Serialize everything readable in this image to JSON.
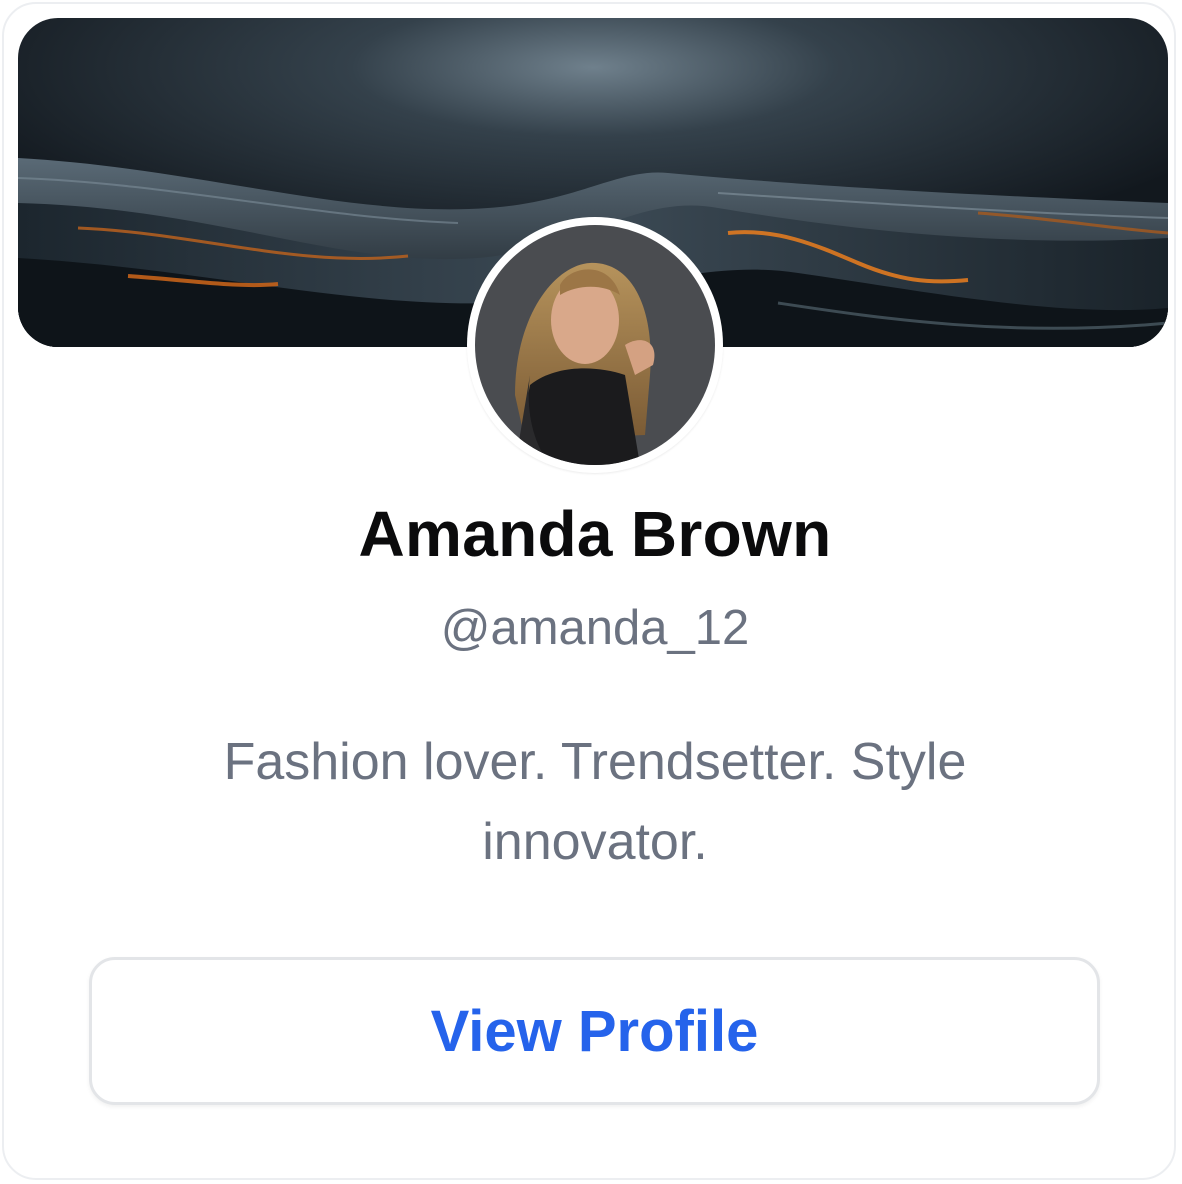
{
  "profile": {
    "name": "Amanda Brown",
    "handle": "@amanda_12",
    "bio": "Fashion lover. Trendsetter. Style innovator.",
    "view_profile_label": "View Profile"
  },
  "colors": {
    "accent": "#2563eb",
    "muted_text": "#6b7280",
    "title_text": "#0b0b0c",
    "border": "#e3e5e8"
  }
}
